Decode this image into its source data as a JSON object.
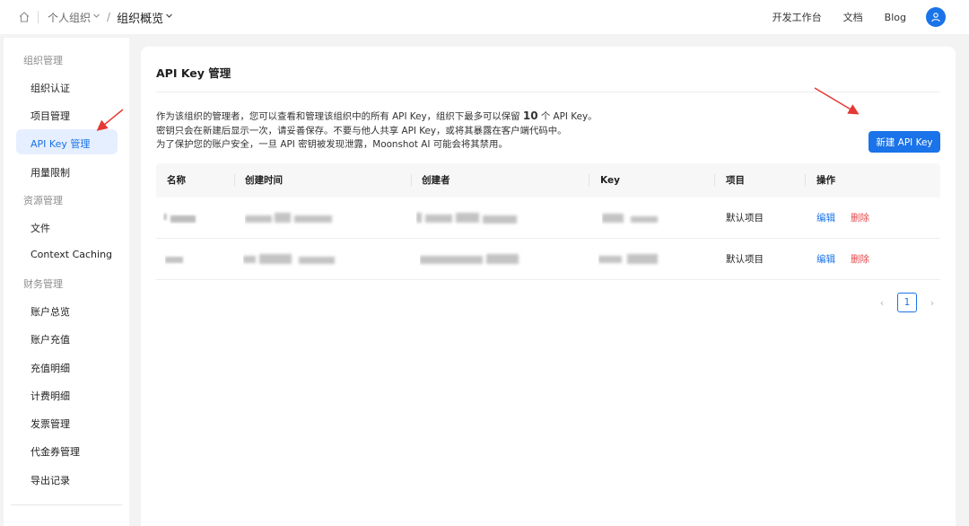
{
  "topbar": {
    "breadcrumb": [
      {
        "label": "个人组织"
      },
      {
        "label": "组织概览"
      }
    ],
    "slash": "/",
    "links": [
      {
        "label": "开发工作台"
      },
      {
        "label": "文档"
      },
      {
        "label": "Blog"
      }
    ],
    "accent": "#1a73e8"
  },
  "sidebar": {
    "sections": [
      {
        "title": "组织管理",
        "items": [
          {
            "label": "组织认证"
          },
          {
            "label": "项目管理"
          },
          {
            "label": "API Key 管理",
            "active": true
          },
          {
            "label": "用量限制"
          }
        ]
      },
      {
        "title": "资源管理",
        "items": [
          {
            "label": "文件"
          },
          {
            "label": "Context Caching"
          }
        ]
      },
      {
        "title": "财务管理",
        "items": [
          {
            "label": "账户总览"
          },
          {
            "label": "账户充值"
          },
          {
            "label": "充值明细"
          },
          {
            "label": "计费明细"
          },
          {
            "label": "发票管理"
          },
          {
            "label": "代金券管理"
          },
          {
            "label": "导出记录"
          }
        ]
      }
    ]
  },
  "main": {
    "title": "API Key 管理",
    "desc_line1_a": "作为该组织的管理者，您可以查看和管理该组织中的所有 API Key，组织下最多可以保留 ",
    "desc_line1_num": "10",
    "desc_line1_b": " 个 API Key。",
    "desc_line2": "密钥只会在新建后显示一次，请妥善保存。不要与他人共享 API Key，或将其暴露在客户端代码中。",
    "desc_line3": "为了保护您的账户安全，一旦 API 密钥被发现泄露，Moonshot AI 可能会将其禁用。",
    "new_button": "新建 API Key",
    "table": {
      "headers": [
        "名称",
        "创建时间",
        "创建者",
        "Key",
        "项目",
        "操作"
      ],
      "rows": [
        {
          "project": "默认项目",
          "edit": "编辑",
          "delete": "删除"
        },
        {
          "project": "默认项目",
          "edit": "编辑",
          "delete": "删除"
        }
      ]
    },
    "pagination": {
      "current": "1",
      "prev": "‹",
      "next": "›"
    }
  }
}
